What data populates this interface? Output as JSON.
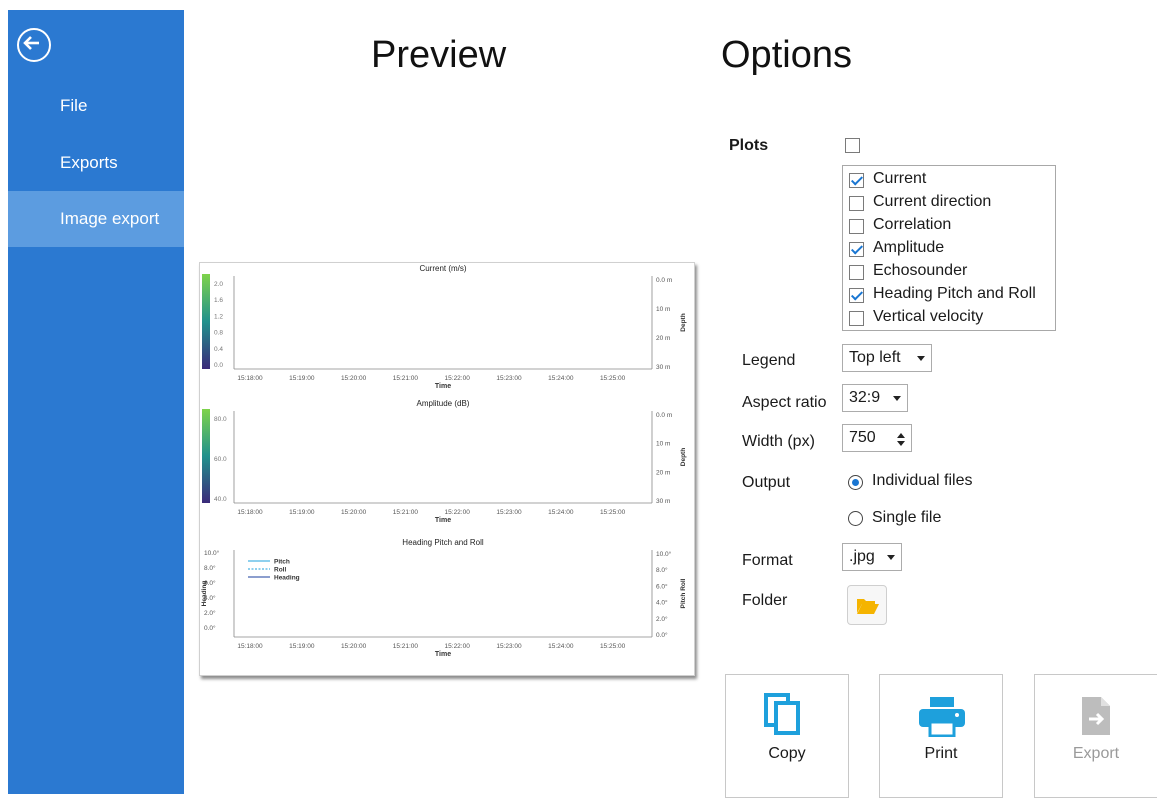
{
  "sidebar": {
    "items": [
      {
        "label": "File"
      },
      {
        "label": "Exports"
      },
      {
        "label": "Image export"
      }
    ]
  },
  "headings": {
    "preview": "Preview",
    "options": "Options"
  },
  "options": {
    "plots_label": "Plots",
    "plots_all_checked": false,
    "plots": [
      {
        "label": "Current",
        "checked": true
      },
      {
        "label": "Current direction",
        "checked": false
      },
      {
        "label": "Correlation",
        "checked": false
      },
      {
        "label": "Amplitude",
        "checked": true
      },
      {
        "label": "Echosounder",
        "checked": false
      },
      {
        "label": "Heading Pitch and Roll",
        "checked": true
      },
      {
        "label": "Vertical velocity",
        "checked": false
      }
    ],
    "legend_label": "Legend",
    "legend_value": "Top left",
    "aspect_label": "Aspect ratio",
    "aspect_value": "32:9",
    "width_label": "Width (px)",
    "width_value": "750",
    "output_label": "Output",
    "output_individual": "Individual files",
    "output_single": "Single file",
    "output_selected": "individual",
    "format_label": "Format",
    "format_value": ".jpg",
    "folder_label": "Folder"
  },
  "actions": {
    "copy": "Copy",
    "print": "Print",
    "export": "Export"
  },
  "colors": {
    "sidebar": "#2b79d1",
    "sidebar_active": "#5c9ce0",
    "accent": "#1976d2",
    "action_icon": "#1ea0dc",
    "folder_icon": "#f5b400"
  },
  "preview": {
    "time_ticks": [
      "15:18:00",
      "15:19:00",
      "15:20:00",
      "15:21:00",
      "15:22:00",
      "15:23:00",
      "15:24:00",
      "15:25:00"
    ],
    "time_label": "Time",
    "charts": [
      {
        "title": "Current (m/s)",
        "colorbar_ticks": [
          "2.0",
          "1.6",
          "1.2",
          "0.8",
          "0.4",
          "0.0"
        ],
        "right_ticks": [
          "0.0 m",
          "10 m",
          "20 m",
          "30 m"
        ],
        "right_label": "Depth"
      },
      {
        "title": "Amplitude (dB)",
        "colorbar_ticks": [
          "80.0",
          "60.0",
          "40.0"
        ],
        "right_ticks": [
          "0.0 m",
          "10 m",
          "20 m",
          "30 m"
        ],
        "right_label": "Depth"
      },
      {
        "title": "Heading Pitch and Roll",
        "left_ticks": [
          "10.0°",
          "8.0°",
          "6.0°",
          "4.0°",
          "2.0°",
          "0.0°"
        ],
        "left_label": "Heading",
        "right_ticks": [
          "10.0°",
          "8.0°",
          "6.0°",
          "4.0°",
          "2.0°",
          "0.0°"
        ],
        "right_label": "Pitch Roll",
        "legend": [
          "Pitch",
          "Roll",
          "Heading"
        ]
      }
    ]
  }
}
